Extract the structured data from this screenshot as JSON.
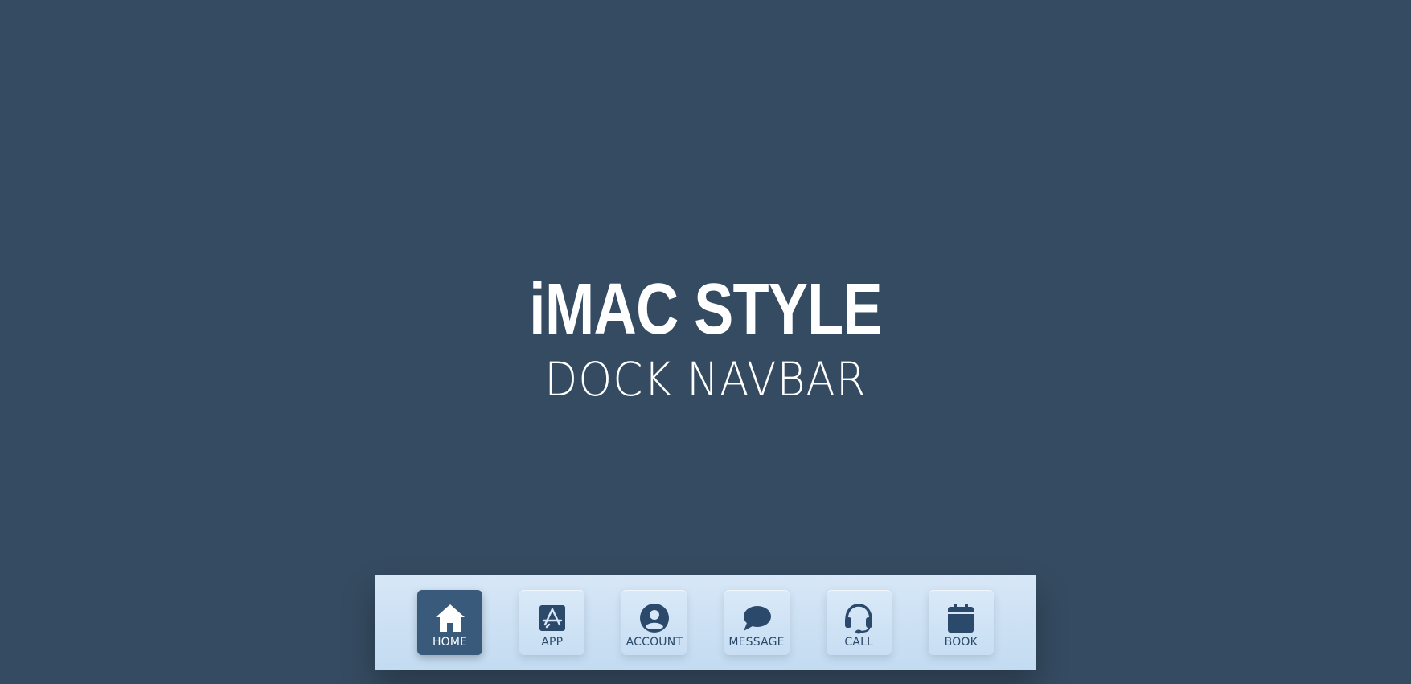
{
  "hero": {
    "title": "iMAC STYLE",
    "subtitle": "DOCK NAVBAR"
  },
  "dock": {
    "items": [
      {
        "label": "HOME",
        "icon": "home-icon",
        "active": true
      },
      {
        "label": "APP",
        "icon": "app-store-icon",
        "active": false
      },
      {
        "label": "ACCOUNT",
        "icon": "account-icon",
        "active": false
      },
      {
        "label": "MESSAGE",
        "icon": "message-icon",
        "active": false
      },
      {
        "label": "CALL",
        "icon": "headset-icon",
        "active": false
      },
      {
        "label": "BOOK",
        "icon": "calendar-icon",
        "active": false
      }
    ]
  },
  "colors": {
    "background": "#354b61",
    "dock": "#cfe2f5",
    "active": "#3a5a7b",
    "icon": "#2b4a6b"
  }
}
